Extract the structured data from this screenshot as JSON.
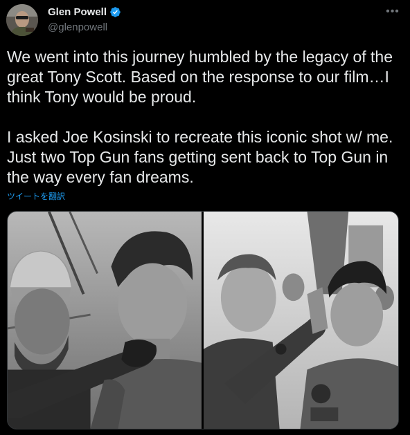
{
  "user": {
    "display_name": "Glen Powell",
    "handle": "@glenpowell",
    "verified": true,
    "avatar_icon": "avatar-photo"
  },
  "tweet": {
    "text": "We went into this journey humbled by the legacy of the great Tony Scott. Based on the response to our film…I think Tony would be proud.\n\nI asked Joe Kosinski to recreate this iconic shot w/ me. Just two Top Gun fans getting sent back to Top Gun in the way every fan dreams.",
    "translate_label": "ツイートを翻訳",
    "more_icon": "more-horizontal-icon"
  },
  "media": {
    "count": 2,
    "photos": [
      {
        "name": "new-scene-photo",
        "style": "black-and-white"
      },
      {
        "name": "original-scene-photo",
        "style": "black-and-white"
      }
    ]
  },
  "colors": {
    "background": "#000000",
    "text": "#e7e9ea",
    "secondary": "#71767b",
    "link": "#1d9bf0",
    "verified": "#1d9bf0"
  }
}
